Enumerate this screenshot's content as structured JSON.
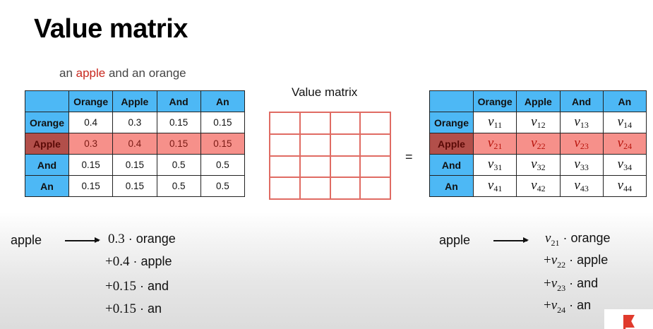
{
  "title": "Value matrix",
  "sentence": {
    "pre": "an ",
    "highlight": "apple",
    "post": " and an orange"
  },
  "value_matrix_label": "Value matrix",
  "equals": "=",
  "attention_table": {
    "headers": [
      "Orange",
      "Apple",
      "And",
      "An"
    ],
    "rows": [
      {
        "label": "Orange",
        "values": [
          "0.4",
          "0.3",
          "0.15",
          "0.15"
        ]
      },
      {
        "label": "Apple",
        "values": [
          "0.3",
          "0.4",
          "0.15",
          "0.15"
        ]
      },
      {
        "label": "And",
        "values": [
          "0.15",
          "0.15",
          "0.5",
          "0.5"
        ]
      },
      {
        "label": "An",
        "values": [
          "0.15",
          "0.15",
          "0.5",
          "0.5"
        ]
      }
    ]
  },
  "result_table": {
    "headers": [
      "Orange",
      "Apple",
      "And",
      "An"
    ],
    "rows": [
      {
        "label": "Orange",
        "values": [
          [
            "v",
            "11"
          ],
          [
            "v",
            "12"
          ],
          [
            "v",
            "13"
          ],
          [
            "v",
            "14"
          ]
        ]
      },
      {
        "label": "Apple",
        "values": [
          [
            "v",
            "21"
          ],
          [
            "v",
            "22"
          ],
          [
            "v",
            "23"
          ],
          [
            "v",
            "24"
          ]
        ]
      },
      {
        "label": "And",
        "values": [
          [
            "v",
            "31"
          ],
          [
            "v",
            "32"
          ],
          [
            "v",
            "33"
          ],
          [
            "v",
            "34"
          ]
        ]
      },
      {
        "label": "An",
        "values": [
          [
            "v",
            "41"
          ],
          [
            "v",
            "42"
          ],
          [
            "v",
            "43"
          ],
          [
            "v",
            "44"
          ]
        ]
      }
    ]
  },
  "left_formula": {
    "word": "apple",
    "terms": [
      {
        "coef": "0.3",
        "word": "orange"
      },
      {
        "coef": "+0.4",
        "word": "apple"
      },
      {
        "coef": "+0.15",
        "word": "and"
      },
      {
        "coef": "+0.15",
        "word": "an"
      }
    ]
  },
  "right_formula": {
    "word": "apple",
    "terms": [
      {
        "sign": "",
        "var": "v",
        "sub": "21",
        "word": "orange"
      },
      {
        "sign": "+",
        "var": "v",
        "sub": "22",
        "word": "apple"
      },
      {
        "sign": "+",
        "var": "v",
        "sub": "23",
        "word": "and"
      },
      {
        "sign": "+",
        "var": "v",
        "sub": "24",
        "word": "an"
      }
    ]
  },
  "colors": {
    "header_blue": "#4db8f5",
    "highlight_row": "#f6908a",
    "highlight_text": "#c8281e",
    "grid_red": "#e06b63"
  }
}
